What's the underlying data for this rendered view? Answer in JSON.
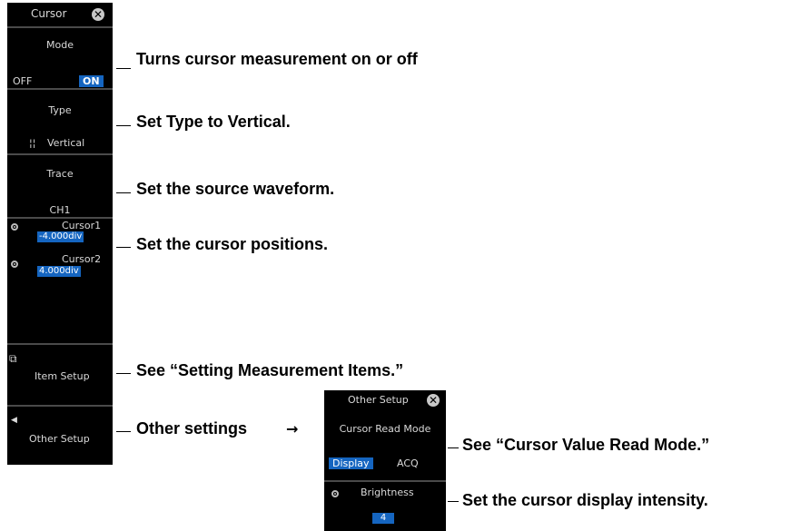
{
  "cursor_menu": {
    "title": "Cursor",
    "mode_label": "Mode",
    "mode_off": "OFF",
    "mode_on": "ON",
    "type_label": "Type",
    "type_glyph": "¦¦",
    "type_value": "Vertical",
    "trace_label": "Trace",
    "trace_value": "CH1",
    "cursor1_label": "Cursor1",
    "cursor1_value": "-4.000div",
    "cursor2_label": "Cursor2",
    "cursor2_value": "4.000div",
    "item_setup_label": "Item Setup",
    "other_setup_label": "Other Setup"
  },
  "other_setup_menu": {
    "title": "Other Setup",
    "read_mode_label": "Cursor Read Mode",
    "read_mode_display": "Display",
    "read_mode_acq": "ACQ",
    "brightness_label": "Brightness",
    "brightness_value": "4"
  },
  "annotations": {
    "mode": "Turns cursor measurement on or off",
    "type": "Set Type to Vertical.",
    "trace": "Set the source waveform.",
    "positions": "Set the cursor positions.",
    "item_setup": "See “Setting Measurement Items.”",
    "other": "Other settings",
    "read_mode": "See “Cursor Value Read Mode.”",
    "brightness": "Set the cursor display intensity."
  },
  "icons": {
    "close": "close-icon",
    "knob": "jog-knob-icon",
    "item_setup": "item-setup-icon",
    "other_setup": "left-arrow-icon"
  },
  "colors": {
    "panel_bg": "#000000",
    "highlight": "#1565c0",
    "text": "#d9d9d9"
  }
}
